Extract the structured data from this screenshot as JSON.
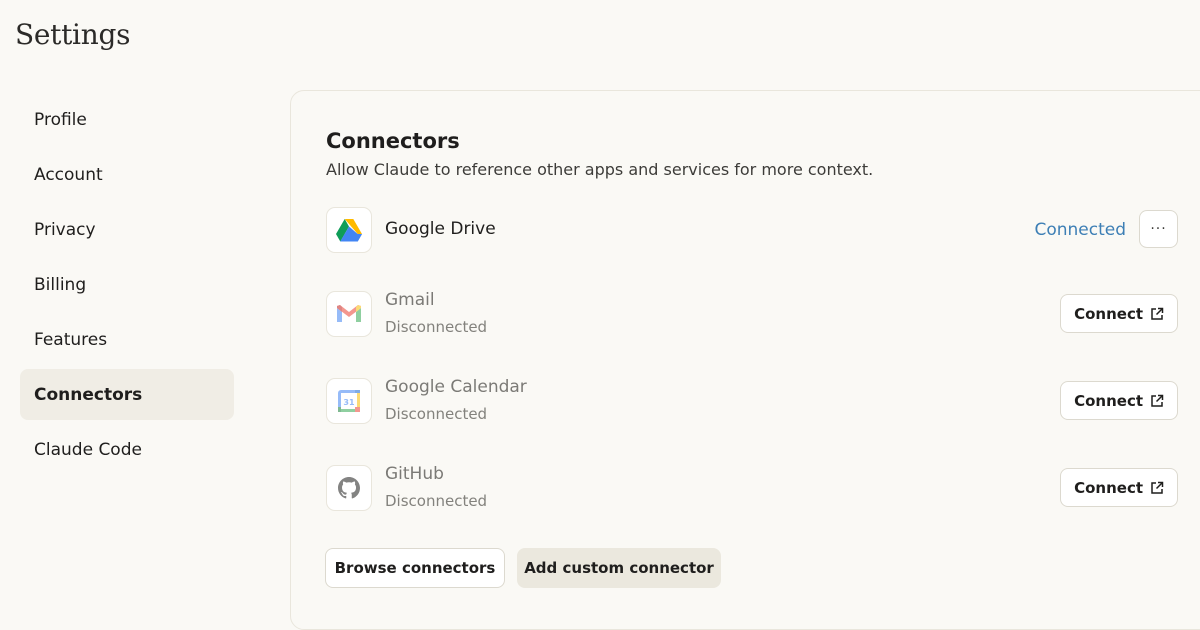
{
  "page": {
    "title": "Settings"
  },
  "sidebar": {
    "items": [
      {
        "label": "Profile",
        "active": false
      },
      {
        "label": "Account",
        "active": false
      },
      {
        "label": "Privacy",
        "active": false
      },
      {
        "label": "Billing",
        "active": false
      },
      {
        "label": "Features",
        "active": false
      },
      {
        "label": "Connectors",
        "active": true
      },
      {
        "label": "Claude Code",
        "active": false
      }
    ]
  },
  "connectors": {
    "title": "Connectors",
    "description": "Allow Claude to reference other apps and services for more context.",
    "items": [
      {
        "name": "Google Drive",
        "icon": "google-drive-icon",
        "status": "Connected",
        "action": "···"
      },
      {
        "name": "Gmail",
        "icon": "gmail-icon",
        "status": "Disconnected",
        "action": "Connect"
      },
      {
        "name": "Google Calendar",
        "icon": "google-calendar-icon",
        "status": "Disconnected",
        "action": "Connect",
        "icon_text": "31"
      },
      {
        "name": "GitHub",
        "icon": "github-icon",
        "status": "Disconnected",
        "action": "Connect"
      }
    ],
    "browse_label": "Browse connectors",
    "add_custom_label": "Add custom connector"
  },
  "colors": {
    "background": "#faf9f5",
    "active_nav": "#f0ede5",
    "connected_text": "#3d7fb5",
    "filled_button": "#ebe8de"
  }
}
